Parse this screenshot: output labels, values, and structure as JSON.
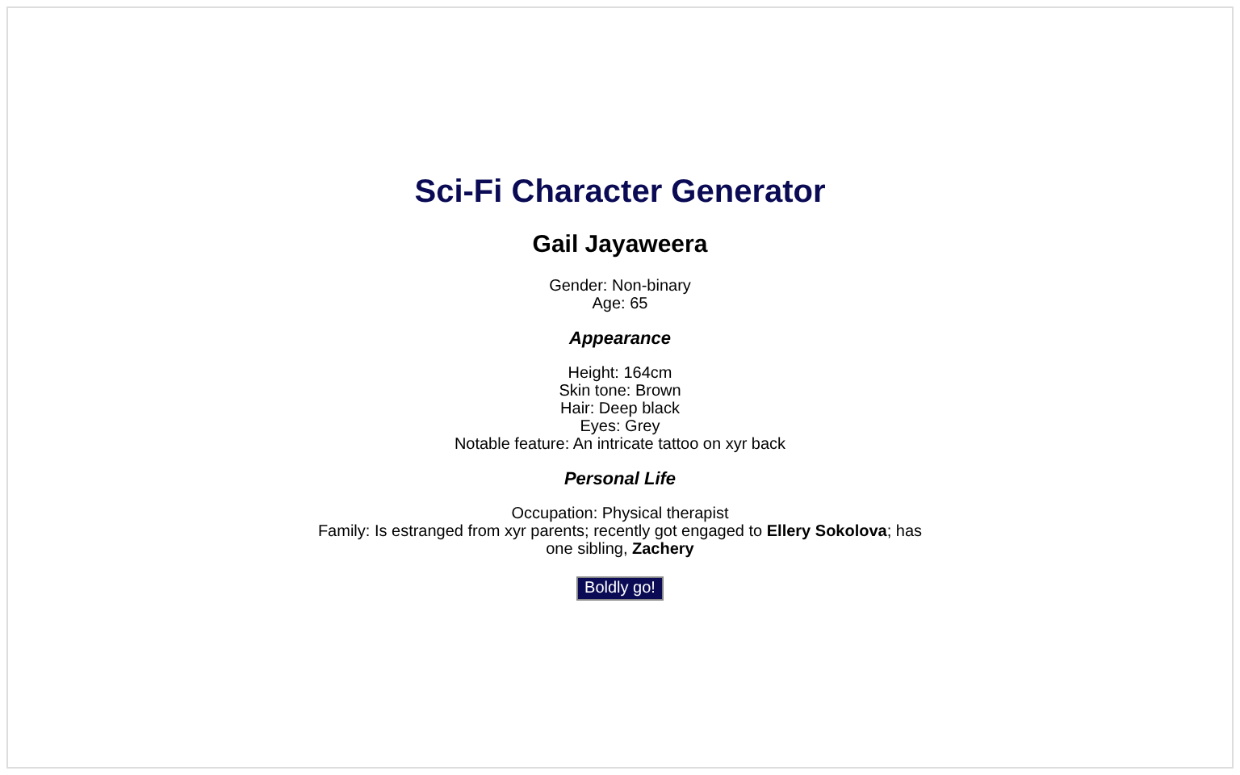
{
  "title": "Sci-Fi Character Generator",
  "character": {
    "name": "Gail Jayaweera",
    "basics": [
      "Gender: Non-binary",
      "Age: 65"
    ],
    "sections": [
      {
        "heading": "Appearance",
        "lines": [
          "Height: 164cm",
          "Skin tone: Brown",
          "Hair: Deep black",
          "Eyes: Grey",
          "Notable feature: An intricate tattoo on xyr back"
        ]
      },
      {
        "heading": "Personal Life",
        "lines": [
          "Occupation: Physical therapist",
          "Family: Is estranged from xyr parents; recently got engaged to **Ellery Sokolova**; has one sibling, **Zachery**"
        ]
      }
    ]
  },
  "button": "Boldly go!"
}
